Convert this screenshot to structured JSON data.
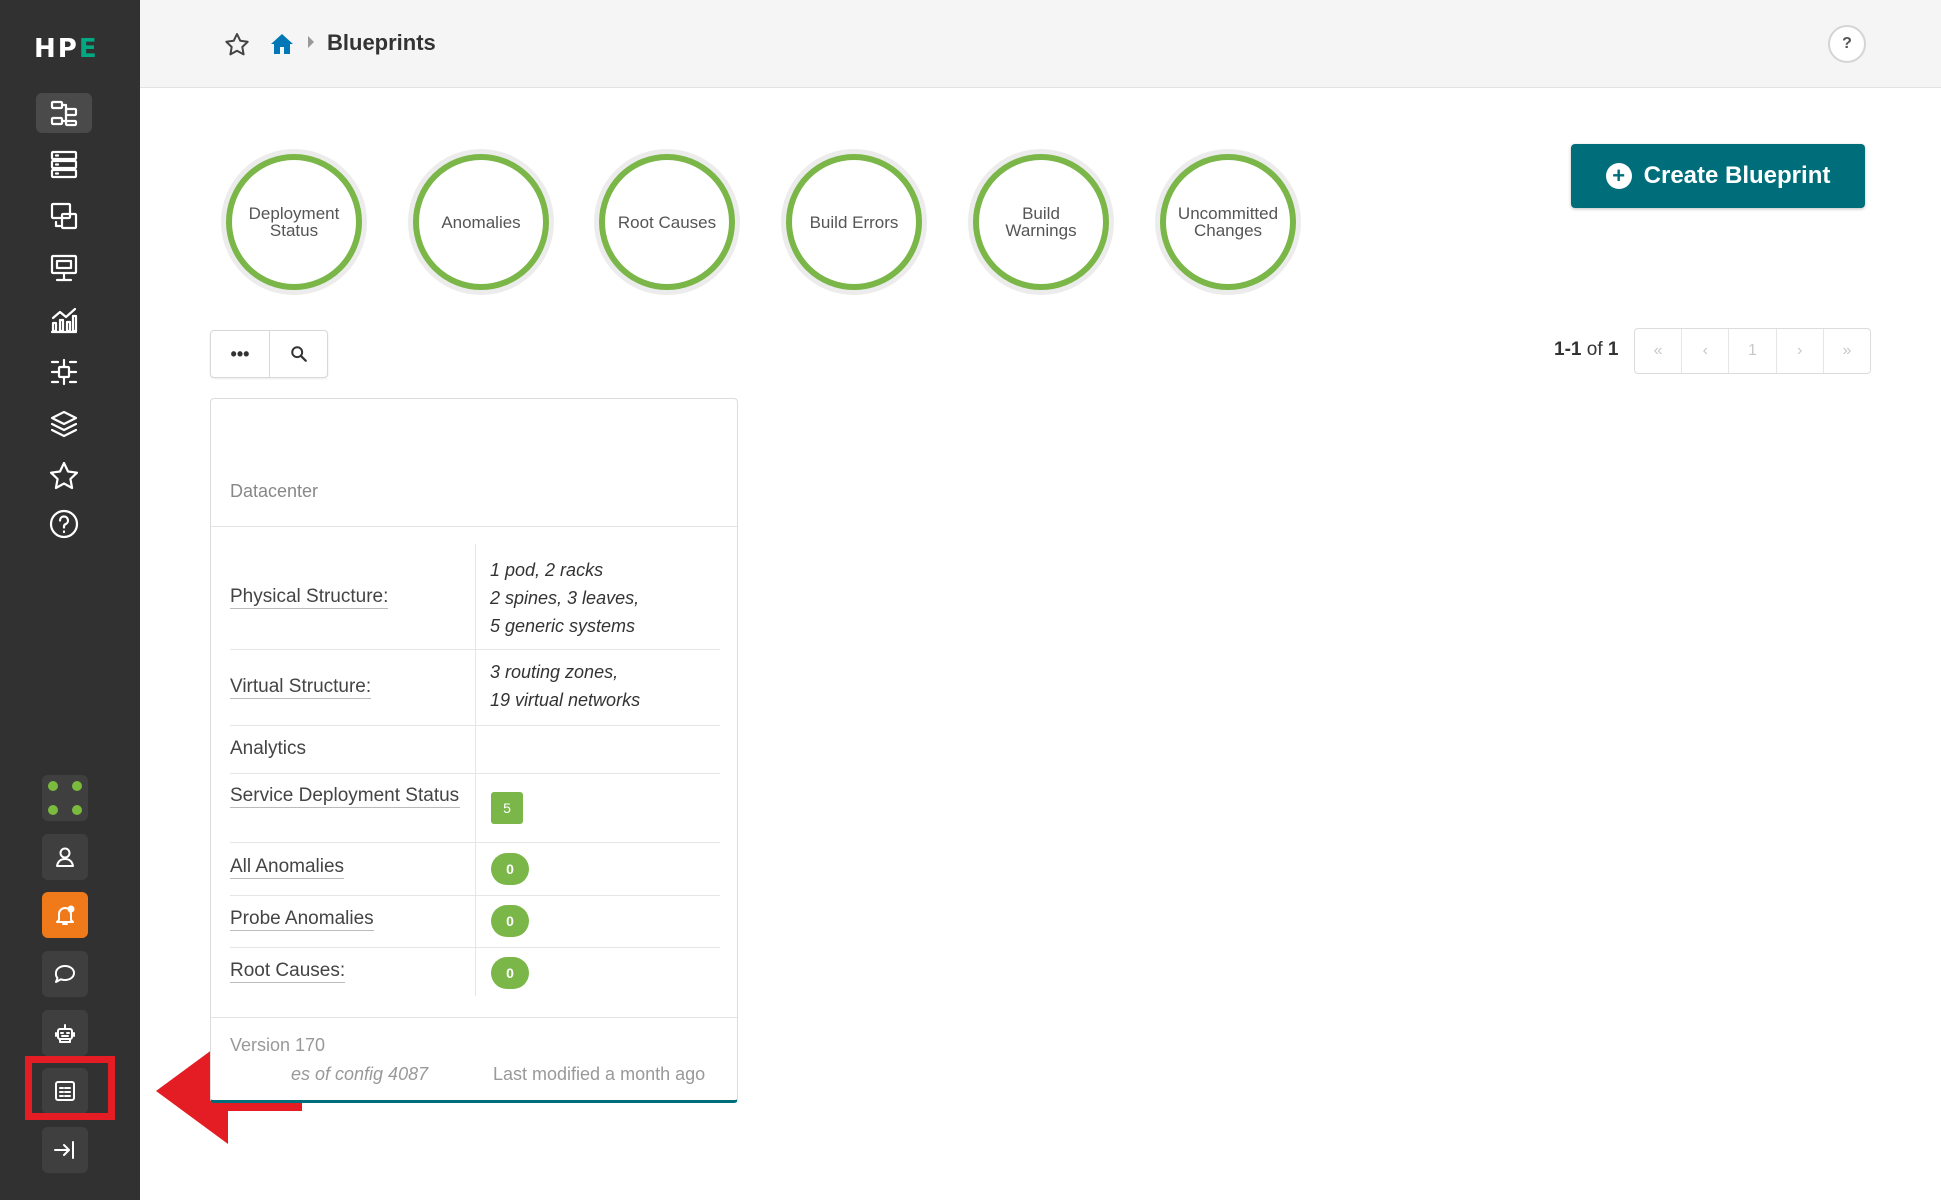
{
  "brand": {
    "logo_main": "HP",
    "logo_accent": "E"
  },
  "header": {
    "title": "Blueprints",
    "help_label": "?"
  },
  "status_rings": [
    "Deployment Status",
    "Anomalies",
    "Root Causes",
    "Build Errors",
    "Build Warnings",
    "Uncommitted Changes"
  ],
  "create_button": {
    "label": "Create Blueprint",
    "plus": "+"
  },
  "toolbar": {
    "more": "•••"
  },
  "pagination": {
    "range": "1-1",
    "of": "of",
    "total": "1",
    "current_page": "1",
    "first": "«",
    "prev": "‹",
    "next": "›",
    "last": "»"
  },
  "card": {
    "type": "Datacenter",
    "rows": [
      {
        "label": "Physical Structure:",
        "lines": [
          "1 pod, 2 racks",
          "2 spines, 3 leaves,",
          "5 generic systems"
        ]
      },
      {
        "label": "Virtual Structure:",
        "lines": [
          "3 routing zones,",
          "19 virtual networks"
        ]
      },
      {
        "label": "Analytics"
      },
      {
        "label": "Service Deployment Status",
        "value": "5"
      },
      {
        "label": "All Anomalies",
        "value": "0"
      },
      {
        "label": "Probe Anomalies",
        "value": "0"
      },
      {
        "label": "Root Causes:",
        "value": "0"
      }
    ],
    "version": "Version 170",
    "config": "es of config 4087",
    "modified": "Last modified a month ago"
  },
  "colors": {
    "sidebar": "#313131",
    "accent": "#006e7a",
    "ring": "#7ab648",
    "highlight": "#e41d24",
    "alert": "#f0791a"
  },
  "icons": {
    "nav": [
      "blueprints-icon",
      "devices-icon",
      "design-icon",
      "resources-icon",
      "analytics-icon",
      "platform-icon",
      "layers-icon",
      "favorites-icon",
      "help-icon"
    ],
    "utility": [
      "apps-grid-icon",
      "user-icon",
      "notifications-icon",
      "chat-icon",
      "robot-icon",
      "dca-icon",
      "expand-sidebar-icon"
    ]
  }
}
